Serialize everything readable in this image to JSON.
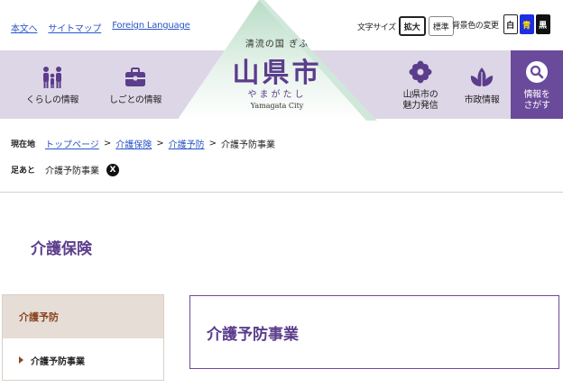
{
  "utility": {
    "links": [
      "本文へ",
      "サイトマップ",
      "Foreign Language"
    ],
    "font_size_label": "文字サイズ",
    "font_size_buttons": [
      "拡大",
      "標準"
    ],
    "bg_color_label": "背景色の変更",
    "bg_color_buttons": [
      "白",
      "青",
      "黒"
    ]
  },
  "logo": {
    "tagline": "清流の国 ぎふ",
    "name": "山県市",
    "kana": "やまがたし",
    "english": "Yamagata City"
  },
  "nav": {
    "living_label": "くらしの情報",
    "work_label": "しごとの情報",
    "charm_label_1": "山県市の",
    "charm_label_2": "魅力発信",
    "city_label": "市政情報",
    "search_label_1": "情報を",
    "search_label_2": "さがす"
  },
  "breadcrumb": {
    "head": "現在地",
    "links": [
      "トップページ",
      "介護保険",
      "介護予防"
    ],
    "current": "介護予防事業"
  },
  "trail": {
    "head": "足あと",
    "item": "介護予防事業",
    "remove": "X"
  },
  "section_title": "介護保険",
  "side_menu": {
    "heading": "介護予防",
    "items": [
      "介護予防事業"
    ]
  },
  "page_title": "介護予防事業",
  "colors": {
    "accent": "#5b3d8c",
    "nav_bg": "#ddd6e6",
    "search_bg": "#6a4a9a",
    "link": "#2a55c8",
    "side_accent": "#8a4520"
  }
}
